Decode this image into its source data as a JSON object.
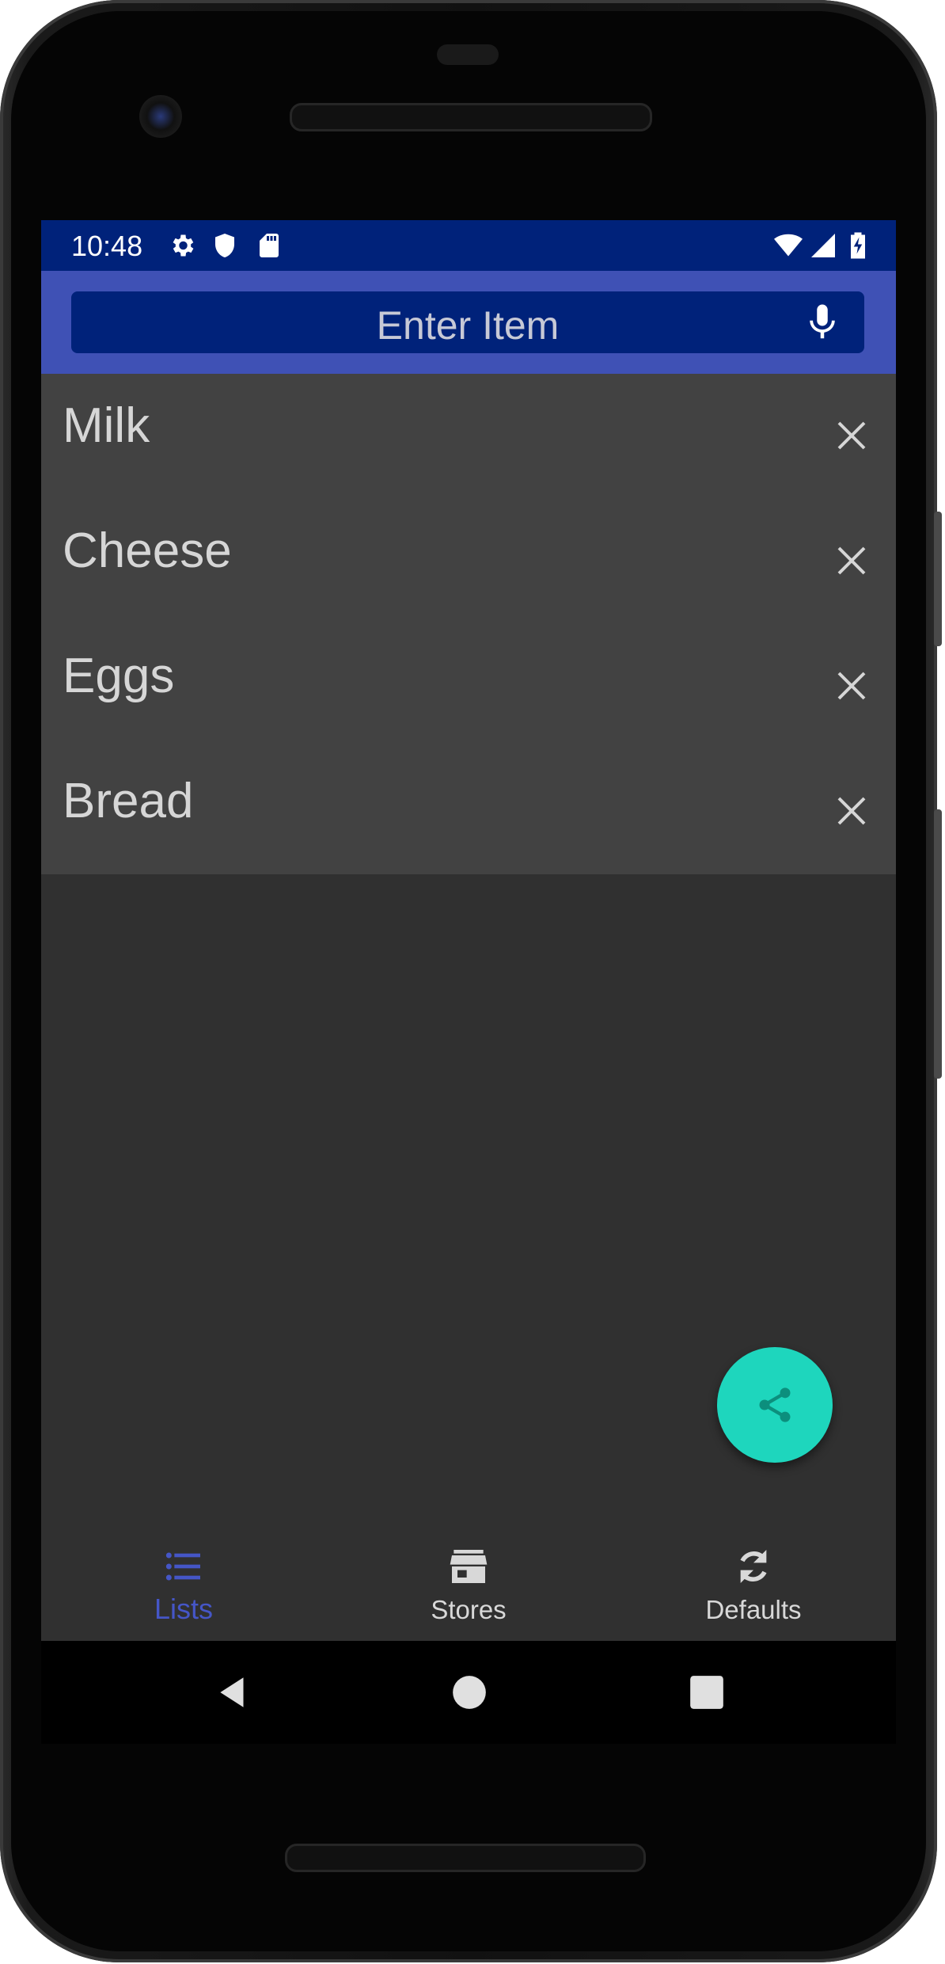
{
  "status_bar": {
    "time": "10:48",
    "background": "#00227a"
  },
  "app_bar": {
    "background": "#3f51b5",
    "search": {
      "placeholder": "Enter Item"
    }
  },
  "items": [
    {
      "label": "Milk"
    },
    {
      "label": "Cheese"
    },
    {
      "label": "Eggs"
    },
    {
      "label": "Bread"
    }
  ],
  "fab": {
    "icon": "share-icon",
    "color": "#1ed6bd"
  },
  "bottom_nav": {
    "active_color": "#4556c7",
    "items": [
      {
        "label": "Lists",
        "icon": "list-icon",
        "active": true
      },
      {
        "label": "Stores",
        "icon": "store-icon",
        "active": false
      },
      {
        "label": "Defaults",
        "icon": "refresh-icon",
        "active": false
      }
    ]
  },
  "system_nav": {
    "buttons": [
      "back-icon",
      "home-icon",
      "recents-icon"
    ]
  }
}
